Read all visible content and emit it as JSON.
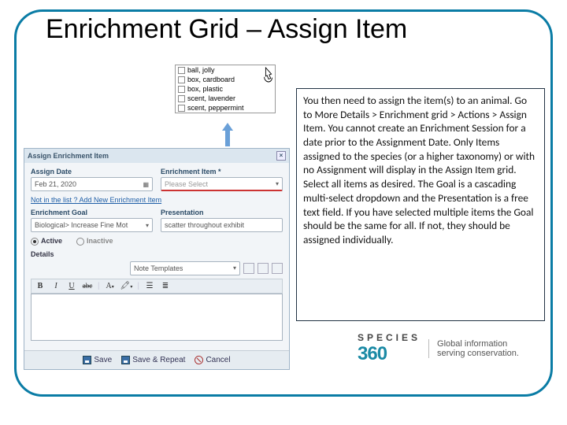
{
  "title": "Enrichment Grid – Assign Item",
  "dropdown": {
    "items": [
      "ball, jolly",
      "box, cardboard",
      "box, plastic",
      "scent, lavender",
      "scent, peppermint"
    ]
  },
  "dialog": {
    "header": "Assign Enrichment Item",
    "assign_date_label": "Assign Date",
    "assign_date_value": "Feb 21, 2020",
    "enrichment_item_label": "Enrichment Item *",
    "enrichment_item_placeholder": "Please Select",
    "not_in_list": "Not in the list ? Add New Enrichment Item",
    "goal_label": "Enrichment Goal",
    "goal_value": "Biological> Increase Fine Mot",
    "presentation_label": "Presentation",
    "presentation_value": "scatter throughout exhibit",
    "radio_active": "Active",
    "radio_inactive": "Inactive",
    "details_header": "Details",
    "note_templates": "Note Templates",
    "toolbar": {
      "bold": "B",
      "italic": "I",
      "underline": "U"
    },
    "footer": {
      "save": "Save",
      "save_repeat": "Save & Repeat",
      "cancel": "Cancel"
    }
  },
  "explainer": "You then need to assign the item(s) to an animal. Go to More Details > Enrichment grid > Actions > Assign Item. You cannot create an Enrichment Session for a date prior to the Assignment Date. Only Items assigned to the species (or a higher taxonomy) or with no Assignment will display in the Assign Item grid. Select all items as desired. The Goal is a cascading multi-select dropdown and the Presentation is a free text field. If you have selected multiple items the Goal should be the same for all. If not, they should be assigned individually.",
  "logo": {
    "brand": "SPECIES",
    "num": "360",
    "tagline1": "Global information",
    "tagline2": "serving conservation."
  }
}
